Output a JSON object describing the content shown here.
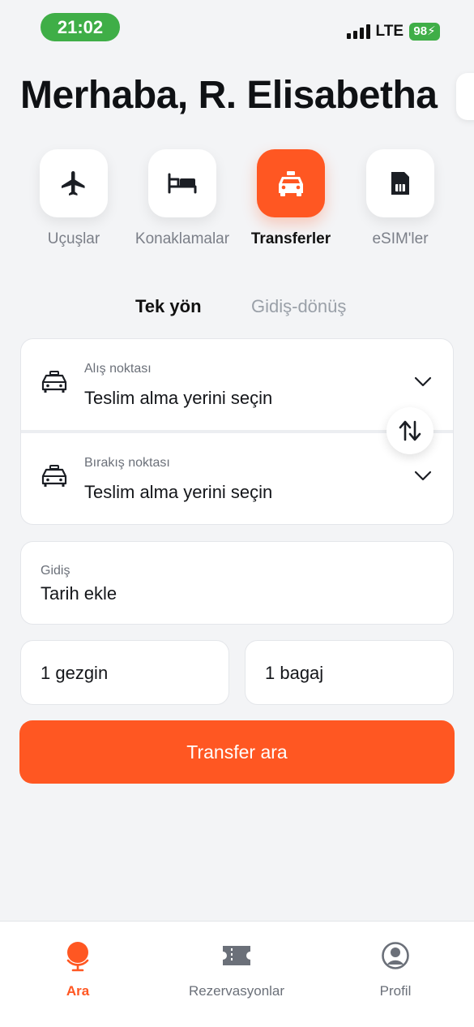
{
  "status_bar": {
    "time": "21:02",
    "network": "LTE",
    "battery": "98"
  },
  "greeting": "Merhaba, R. Elisabetha",
  "categories": [
    {
      "label": "Uçuşlar",
      "icon": "airplane-icon",
      "active": false
    },
    {
      "label": "Konaklamalar",
      "icon": "bed-icon",
      "active": false
    },
    {
      "label": "Transferler",
      "icon": "taxi-icon",
      "active": true
    },
    {
      "label": "eSIM'ler",
      "icon": "sim-card-icon",
      "active": false
    }
  ],
  "trip_tabs": {
    "one_way": "Tek yön",
    "round_trip": "Gidiş-dönüş",
    "selected": "one_way"
  },
  "pickup": {
    "label": "Alış noktası",
    "value": "Teslim alma yerini seçin"
  },
  "dropoff": {
    "label": "Bırakış noktası",
    "value": "Teslim alma yerini seçin"
  },
  "date": {
    "label": "Gidiş",
    "value": "Tarih ekle"
  },
  "travelers": "1 gezgin",
  "luggage": "1 bagaj",
  "search_button": "Transfer ara",
  "bottom_nav": [
    {
      "label": "Ara",
      "icon": "globe-icon",
      "active": true
    },
    {
      "label": "Rezervasyonlar",
      "icon": "ticket-icon",
      "active": false
    },
    {
      "label": "Profil",
      "icon": "profile-icon",
      "active": false
    }
  ],
  "colors": {
    "accent": "#ff5722",
    "status_green": "#3fae47",
    "background": "#f3f4f6"
  }
}
